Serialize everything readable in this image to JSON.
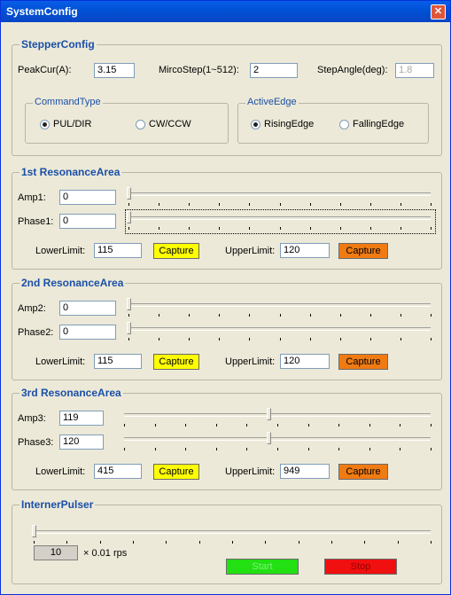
{
  "window": {
    "title": "SystemConfig"
  },
  "stepper": {
    "title": "StepperConfig",
    "peakcur_label": "PeakCur(A):",
    "peakcur_value": "3.15",
    "microstep_label": "MircoStep(1~512):",
    "microstep_value": "2",
    "stepangle_label": "StepAngle(deg):",
    "stepangle_value": "1.8",
    "command_type": {
      "title": "CommandType",
      "options": [
        "PUL/DIR",
        "CW/CCW"
      ],
      "selected": "PUL/DIR"
    },
    "active_edge": {
      "title": "ActiveEdge",
      "options": [
        "RisingEdge",
        "FallingEdge"
      ],
      "selected": "RisingEdge"
    }
  },
  "areas": [
    {
      "title": "1st ResonanceArea",
      "amp_label": "Amp1:",
      "amp_value": "0",
      "amp_level": 0,
      "phase_label": "Phase1:",
      "phase_value": "0",
      "phase_level": 0,
      "lower_label": "LowerLimit:",
      "lower_value": "115",
      "upper_label": "UpperLimit:",
      "upper_value": "120"
    },
    {
      "title": "2nd ResonanceArea",
      "amp_label": "Amp2:",
      "amp_value": "0",
      "amp_level": 0,
      "phase_label": "Phase2:",
      "phase_value": "0",
      "phase_level": 0,
      "lower_label": "LowerLimit:",
      "lower_value": "115",
      "upper_label": "UpperLimit:",
      "upper_value": "120"
    },
    {
      "title": "3rd ResonanceArea",
      "amp_label": "Amp3:",
      "amp_value": "119",
      "amp_level": 0.47,
      "phase_label": "Phase3:",
      "phase_value": "120",
      "phase_level": 0.47,
      "lower_label": "LowerLimit:",
      "lower_value": "415",
      "upper_label": "UpperLimit:",
      "upper_value": "949"
    }
  ],
  "capture_label": "Capture",
  "pulser": {
    "title": "InternerPulser",
    "speed_value": "10",
    "speed_unit": "× 0.01 rps",
    "speed_level": 0,
    "start_label": "Start",
    "stop_label": "Stop"
  },
  "colors": {
    "capture_lower": "#ffff00",
    "capture_upper": "#f07b12",
    "start": "#22e012",
    "stop": "#f01010"
  }
}
